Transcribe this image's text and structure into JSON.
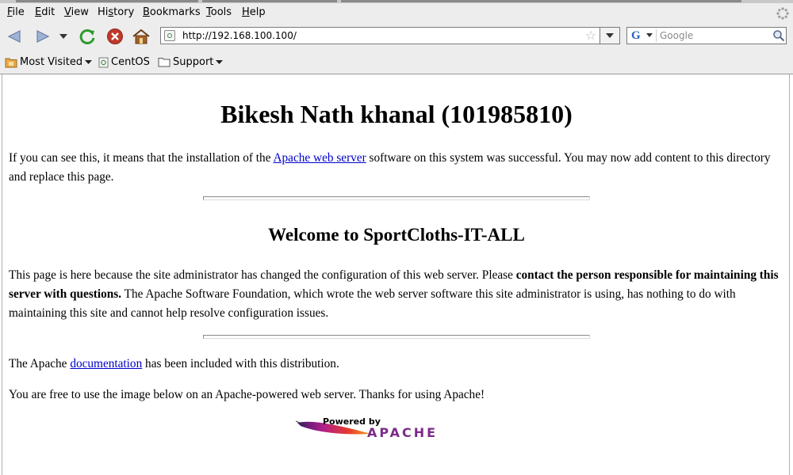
{
  "menu": {
    "file": {
      "acc": "F",
      "rest": "ile"
    },
    "edit": {
      "acc": "E",
      "rest": "dit"
    },
    "view": {
      "acc": "V",
      "rest": "iew"
    },
    "history": {
      "pre": "Hi",
      "acc": "s",
      "rest": "tory"
    },
    "bookmarks": {
      "acc": "B",
      "rest": "ookmarks"
    },
    "tools": {
      "acc": "T",
      "rest": "ools"
    },
    "help": {
      "acc": "H",
      "rest": "elp"
    }
  },
  "navigation": {
    "url": "http://192.168.100.100/",
    "search_placeholder": "Google"
  },
  "bookmarks_toolbar": {
    "most_visited": "Most Visited",
    "centos": "CentOS",
    "support": "Support"
  },
  "page": {
    "title": "Bikesh Nath khanal (101985810)",
    "p1_before": "If you can see this, it means that the installation of the ",
    "p1_link": "Apache web server",
    "p1_after": " software on this system was successful. You may now add content to this directory and replace this page.",
    "subtitle": "Welcome to SportCloths-IT-ALL",
    "p2_before": "This page is here because the site administrator has changed the configuration of this web server. Please ",
    "p2_bold": "contact the person responsible for maintaining this server with questions.",
    "p2_after": " The Apache Software Foundation, which wrote the web server software this site administrator is using, has nothing to do with maintaining this site and cannot help resolve configuration issues.",
    "p3_before": "The Apache ",
    "p3_link": "documentation",
    "p3_after": " has been included with this distribution.",
    "p4": "You are free to use the image below on an Apache-powered web server. Thanks for using Apache!",
    "logo_powered_by": "Powered by",
    "logo_apache": "APACHE"
  },
  "icons": {
    "back": "back-arrow-icon",
    "forward": "forward-arrow-icon",
    "reload": "reload-icon",
    "stop": "stop-icon",
    "home": "home-icon",
    "bookmark_star": "star-icon",
    "search_go": "magnifier-icon"
  },
  "colors": {
    "chrome_bg": "#ededed",
    "link": "#0000cc",
    "reload_green": "#2e9a2e",
    "stop_red": "#c0392b",
    "home_brown": "#a0602a"
  }
}
